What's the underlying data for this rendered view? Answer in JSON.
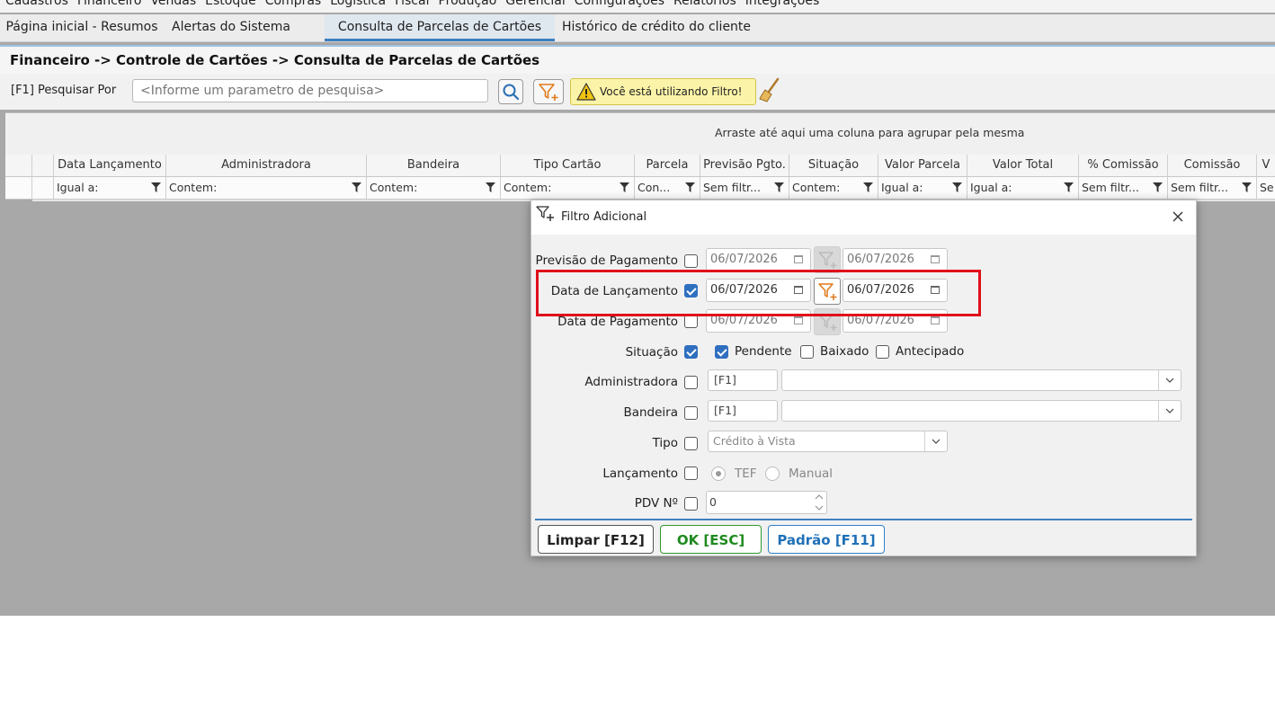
{
  "menu": [
    "Cadastros",
    "Financeiro",
    "Vendas",
    "Estoque",
    "Compras",
    "Logística",
    "Fiscal",
    "Produção",
    "Gerencial",
    "Configurações",
    "Relatórios",
    "Integrações"
  ],
  "tabs": [
    {
      "label": "Página inicial - Resumos"
    },
    {
      "label": "Alertas do Sistema"
    },
    {
      "label": "Consulta de Parcelas de Cartões",
      "active": true
    },
    {
      "label": "Histórico de crédito do cliente"
    }
  ],
  "breadcrumb": "Financeiro -> Controle de Cartões -> Consulta de Parcelas de Cartões",
  "search": {
    "label": "[F1] Pesquisar Por",
    "placeholder": "<Informe um parametro de pesquisa>",
    "warning": "Você está utilizando Filtro!"
  },
  "grid": {
    "group_hint": "Arraste até aqui uma coluna para agrupar pela mesma",
    "columns": [
      {
        "header": "Data Lançamento",
        "filter": "Igual a:"
      },
      {
        "header": "Administradora",
        "filter": "Contem:"
      },
      {
        "header": "Bandeira",
        "filter": "Contem:"
      },
      {
        "header": "Tipo Cartão",
        "filter": "Contem:"
      },
      {
        "header": "Parcela",
        "filter": "Con..."
      },
      {
        "header": "Previsão Pgto.",
        "filter": "Sem filtr..."
      },
      {
        "header": "Situação",
        "filter": "Contem:"
      },
      {
        "header": "Valor Parcela",
        "filter": "Igual a:"
      },
      {
        "header": "Valor Total",
        "filter": "Igual a:"
      },
      {
        "header": "% Comissão",
        "filter": "Sem filtr..."
      },
      {
        "header": "Comissão",
        "filter": "Sem filtr..."
      },
      {
        "header": "V",
        "filter": "Se"
      }
    ]
  },
  "dialog": {
    "title": "Filtro Adicional",
    "rows": {
      "previsao": {
        "label": "Previsão de Pagamento",
        "checked": false,
        "from": "06/07/2026",
        "to": "06/07/2026"
      },
      "lancamento": {
        "label": "Data de Lançamento",
        "checked": true,
        "from": "06/07/2026",
        "to": "06/07/2026"
      },
      "pagamento": {
        "label": "Data de Pagamento",
        "checked": false,
        "from": "06/07/2026",
        "to": "06/07/2026"
      },
      "situacao": {
        "label": "Situação",
        "checked": true,
        "options": [
          {
            "label": "Pendente",
            "checked": true
          },
          {
            "label": "Baixado",
            "checked": false
          },
          {
            "label": "Antecipado",
            "checked": false
          }
        ]
      },
      "administradora": {
        "label": "Administradora",
        "checked": false,
        "code": "[F1]",
        "value": ""
      },
      "bandeira": {
        "label": "Bandeira",
        "checked": false,
        "code": "[F1]",
        "value": ""
      },
      "tipo": {
        "label": "Tipo",
        "checked": false,
        "value": "Crédito à Vista"
      },
      "lancamento_tipo": {
        "label": "Lançamento",
        "checked": false,
        "options": [
          {
            "label": "TEF",
            "selected": true
          },
          {
            "label": "Manual",
            "selected": false
          }
        ]
      },
      "pdv": {
        "label": "PDV Nº",
        "checked": false,
        "value": "0"
      }
    },
    "buttons": {
      "clear": "Limpar [F12]",
      "ok": "OK [ESC]",
      "default": "Padrão [F11]"
    }
  },
  "colors": {
    "accent": "#3f7fbf",
    "highlight": "#e0101a",
    "ok": "#1e8a1e",
    "default": "#2070b8",
    "warning_bg": "#fbf4a8"
  }
}
